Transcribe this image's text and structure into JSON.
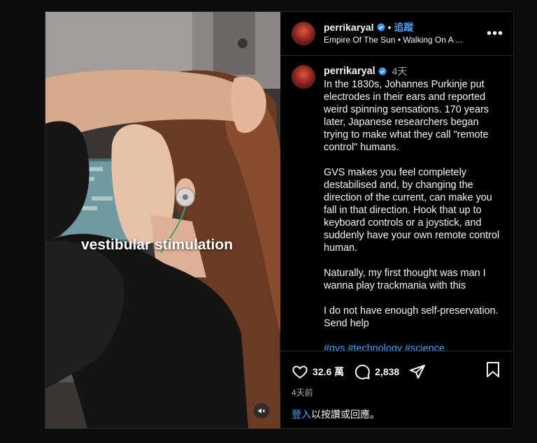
{
  "media": {
    "overlay_text": "vestibular stimulation",
    "mute_icon": "speaker-muted-icon"
  },
  "header": {
    "username": "perrikaryal",
    "dot": "•",
    "follow_label": "追蹤",
    "music": "Empire Of The Sun • Walking On A ...",
    "more_label": "•••"
  },
  "caption": {
    "username": "perrikaryal",
    "time": "4天",
    "paragraphs": [
      "In the 1830s, Johannes Purkinje put electrodes in their ears and reported weird spinning sensations. 170 years later, Japanese researchers began trying to make what they call \"remote control\" humans.",
      "GVS makes you feel completely destabilised and, by changing the direction of the current, can make you fall in that direction. Hook that up to keyboard controls or a joystick, and suddenly have your own remote control human.",
      "Naturally, my first thought was man I wanna play trackmania with this",
      "I do not have enough self-preservation. Send help"
    ],
    "hashtags": [
      "#gvs",
      "#technology",
      "#science"
    ]
  },
  "actions": {
    "likes": "32.6 萬",
    "comments": "2,838",
    "posted_ago": "4天前"
  },
  "login": {
    "link": "登入",
    "rest": "以按讚或回應。"
  },
  "colors": {
    "accent": "#4a9ff5",
    "background": "#000000",
    "verified": "#3897f0"
  }
}
